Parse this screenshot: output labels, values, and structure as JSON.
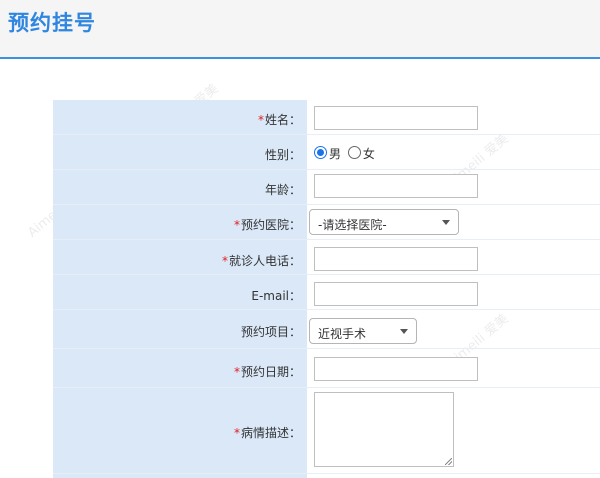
{
  "header": {
    "title": "预约挂号"
  },
  "form": {
    "required_mark": "*",
    "name": {
      "label": "姓名：",
      "value": ""
    },
    "gender": {
      "label": "性别：",
      "options": [
        "男",
        "女"
      ],
      "selected": "男"
    },
    "age": {
      "label": "年龄：",
      "value": ""
    },
    "hospital": {
      "label": "预约医院：",
      "selected": "-请选择医院-"
    },
    "phone": {
      "label": "就诊人电话：",
      "value": ""
    },
    "email": {
      "label": "E-mail：",
      "value": ""
    },
    "project": {
      "label": "预约项目：",
      "selected": "近视手术"
    },
    "date": {
      "label": "预约日期：",
      "value": ""
    },
    "description": {
      "label": "病情描述：",
      "value": ""
    }
  },
  "colors": {
    "accent": "#2f86e0",
    "label_bg": "#dae8f8",
    "required": "#e02020"
  }
}
